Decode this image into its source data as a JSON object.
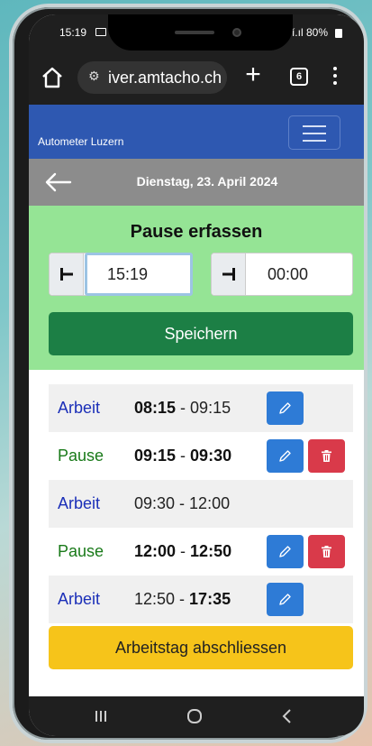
{
  "status": {
    "time": "15:19",
    "signal": "í.ıl 80%"
  },
  "browser": {
    "url": "iver.amtacho.ch",
    "tab_count": "6",
    "icons": [
      "home-icon",
      "site-settings-icon",
      "plus-icon",
      "tab-switcher-icon",
      "more-vert-icon"
    ]
  },
  "appbar": {
    "brand": "Autometer Luzern"
  },
  "datebar": {
    "date": "Dienstag, 23. April 2024"
  },
  "pause_form": {
    "title": "Pause erfassen",
    "start_value": "15:19",
    "end_value": "00:00",
    "save_label": "Speichern"
  },
  "entries": [
    {
      "kind": "Arbeit",
      "type": "arbeit",
      "start": "08:15",
      "sep": " - ",
      "end": "09:15",
      "start_bold": true,
      "end_bold": false,
      "edit": true,
      "delete": false
    },
    {
      "kind": "Pause",
      "type": "pause",
      "start": "09:15",
      "sep": " - ",
      "end": "09:30",
      "start_bold": true,
      "end_bold": true,
      "edit": true,
      "delete": true
    },
    {
      "kind": "Arbeit",
      "type": "arbeit",
      "start": "09:30",
      "sep": " - ",
      "end": "12:00",
      "start_bold": false,
      "end_bold": false,
      "edit": false,
      "delete": false
    },
    {
      "kind": "Pause",
      "type": "pause",
      "start": "12:00",
      "sep": " - ",
      "end": "12:50",
      "start_bold": true,
      "end_bold": true,
      "edit": true,
      "delete": true
    },
    {
      "kind": "Arbeit",
      "type": "arbeit",
      "start": "12:50",
      "sep": " - ",
      "end": "17:35",
      "start_bold": false,
      "end_bold": true,
      "edit": true,
      "delete": false
    }
  ],
  "finish_label": "Arbeitstag abschliessen",
  "colors": {
    "appbar": "#2e58b1",
    "pause_panel": "#95e495",
    "save": "#1c7f45",
    "edit": "#2e7bd6",
    "delete": "#d93a4a",
    "finish": "#f6c41a",
    "arbeit_text": "#1b2fb8",
    "pause_text": "#197a19"
  }
}
